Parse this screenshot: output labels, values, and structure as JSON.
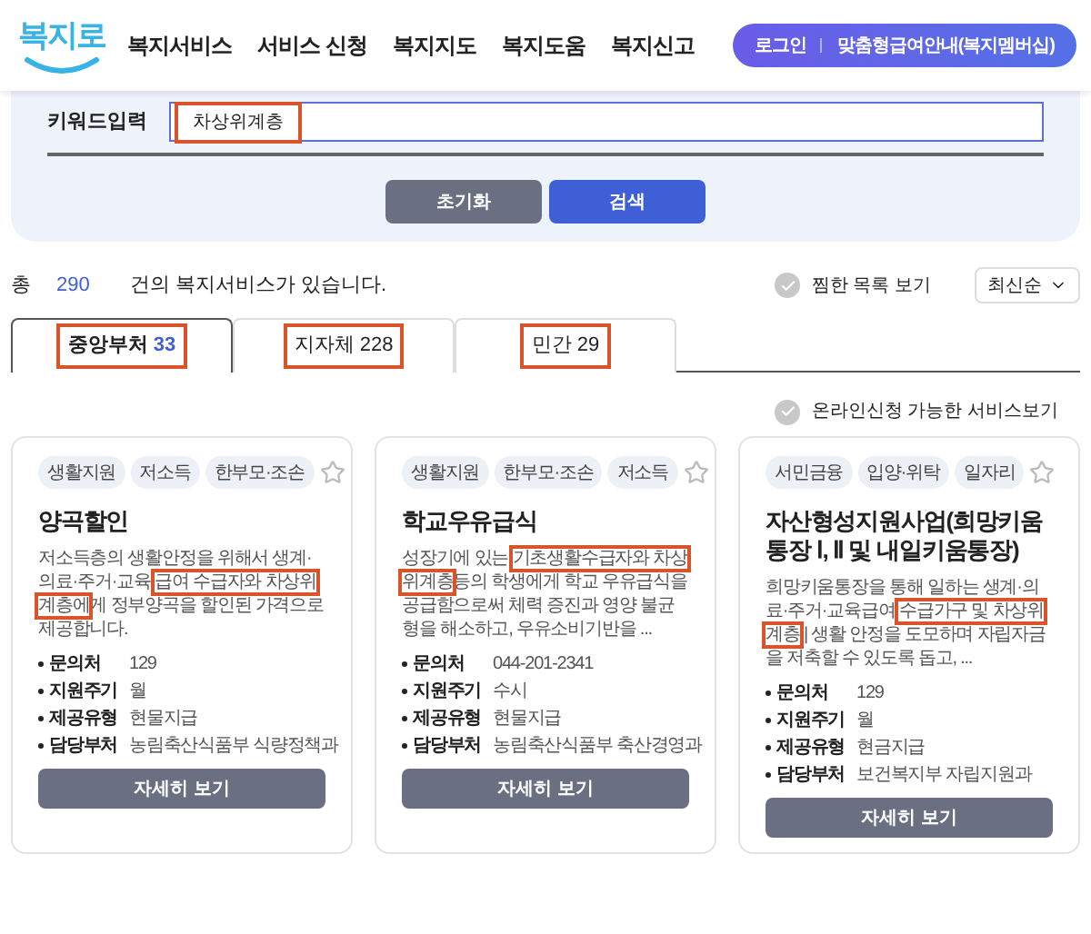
{
  "header": {
    "logo": "복지로",
    "nav": [
      "복지서비스",
      "서비스 신청",
      "복지지도",
      "복지도움",
      "복지신고"
    ],
    "login": "로그인",
    "membership": "맞춤형급여안내(복지멤버십)"
  },
  "search": {
    "label": "키워드입력",
    "value": "차상위계층",
    "value_highlighted": true,
    "reset": "초기화",
    "submit": "검색"
  },
  "summary": {
    "prefix": "총",
    "count": "290",
    "suffix": "건의 복지서비스가 있습니다.",
    "favorites": "찜한 목록 보기",
    "sort": "최신순"
  },
  "tabs": [
    {
      "label": "중앙부처",
      "count": "33",
      "selected": true,
      "highlighted": true
    },
    {
      "label": "지자체",
      "count": "228",
      "selected": false,
      "highlighted": true
    },
    {
      "label": "민간",
      "count": "29",
      "selected": false,
      "highlighted": true
    }
  ],
  "online_filter": "온라인신청 가능한 서비스보기",
  "cards": [
    {
      "tags": [
        "생활지원",
        "저소득",
        "한부모·조손"
      ],
      "title": "양곡할인",
      "desc": [
        {
          "text": "저소득층의 생활안정을 위해서 생계·의료·주거·교육 ",
          "highlighted": false
        },
        {
          "text": "급여 수급자와 차상위계층에",
          "highlighted": true
        },
        {
          "text": "게  정부양곡을 할인된 가격으로 제공합니다.",
          "highlighted": false
        }
      ],
      "info": [
        {
          "label": "문의처",
          "value": "129"
        },
        {
          "label": "지원주기",
          "value": "월"
        },
        {
          "label": "제공유형",
          "value": "현물지급"
        },
        {
          "label": "담당부처",
          "value": "농림축산식품부 식량정책과"
        }
      ],
      "button": "자세히 보기"
    },
    {
      "tags": [
        "생활지원",
        "한부모·조손",
        "저소득"
      ],
      "title": "학교우유급식",
      "desc": [
        {
          "text": "성장기에 있는 ",
          "highlighted": false
        },
        {
          "text": "기초생활수급자와 차상위계층",
          "highlighted": true
        },
        {
          "text": "등의 학생에게 학교 우유급식을 공급함으로써 체력 증진과 영양 불균형을 해소하고, 우유소비기반을 ...",
          "highlighted": false
        }
      ],
      "info": [
        {
          "label": "문의처",
          "value": "044-201-2341"
        },
        {
          "label": "지원주기",
          "value": "수시"
        },
        {
          "label": "제공유형",
          "value": "현물지급"
        },
        {
          "label": "담당부처",
          "value": "농림축산식품부 축산경영과"
        }
      ],
      "button": "자세히 보기"
    },
    {
      "tags": [
        "서민금융",
        "입양·위탁",
        "일자리"
      ],
      "title": "자산형성지원사업(희망키움통장 Ⅰ, Ⅱ 및 내일키움통장)",
      "desc": [
        {
          "text": "희망키움통장을 통해 일하는 생계·의료·주거·교육급여 ",
          "highlighted": false
        },
        {
          "text": "수급가구 및 차상위계층",
          "highlighted": true
        },
        {
          "text": " | 생활 안정을 도모하며 자립자금을 저축할 수 있도록 돕고, ...",
          "highlighted": false
        }
      ],
      "info": [
        {
          "label": "문의처",
          "value": "129"
        },
        {
          "label": "지원주기",
          "value": "월"
        },
        {
          "label": "제공유형",
          "value": "현금지급"
        },
        {
          "label": "담당부처",
          "value": "보건복지부 자립지원과"
        }
      ],
      "button": "자세히 보기"
    }
  ]
}
